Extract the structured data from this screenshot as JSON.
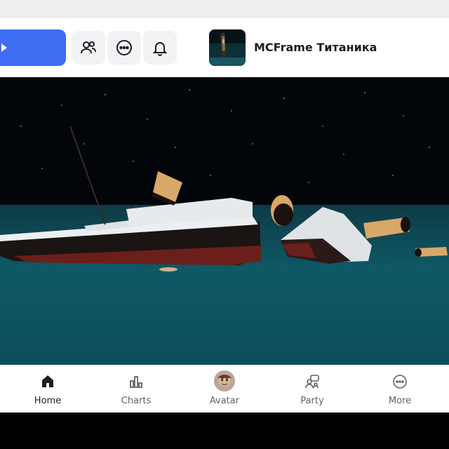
{
  "colors": {
    "accent": "#3f6ef5",
    "header_bg": "#ffffff",
    "ocean": "#0f5563",
    "sky": "#02060a"
  },
  "header": {
    "game_title": "MCFrame Титаника",
    "icons": [
      "play-icon",
      "friends-icon",
      "more-options-icon",
      "notifications-bell-icon"
    ]
  },
  "nav": {
    "items": [
      {
        "label": "Home",
        "icon": "home-icon",
        "active": true
      },
      {
        "label": "Charts",
        "icon": "charts-icon",
        "active": false
      },
      {
        "label": "Avatar",
        "icon": "avatar-icon",
        "active": false
      },
      {
        "label": "Party",
        "icon": "party-icon",
        "active": false
      },
      {
        "label": "More",
        "icon": "more-icon",
        "active": false
      }
    ]
  }
}
